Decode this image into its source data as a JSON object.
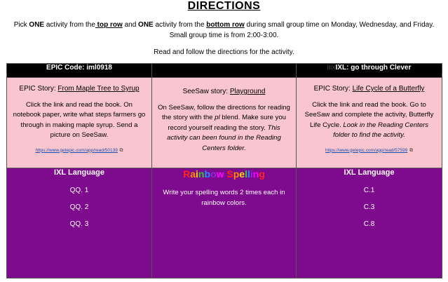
{
  "title": "DIRECTIONS",
  "intro": {
    "part1": "Pick ",
    "one_a": "ONE",
    "part2": " activity from the",
    "top_row": " top row",
    "part3": " and ",
    "one_b": "ONE",
    "part4": " activity from the ",
    "bottom_row": "bottom row",
    "part5": " during small group time on Monday, Wednesday, and Friday.  Small group time is from 2:00-3:00."
  },
  "read_follow": "Read and follow the directions for the activity.",
  "header": {
    "col1": "EPIC Code:  iml0918",
    "col2": "",
    "col3_ghost": "IIIX",
    "col3": "IXL:  go through Clever"
  },
  "top_row": {
    "epic": {
      "prefix": "EPIC Story:  ",
      "title": "From Maple Tree to Syrup",
      "body": "Click the link and read the book.  On notebook paper, write what steps farmers go through in making maple syrup. Send a picture on SeeSaw.",
      "link": "https://www.getepic.com/app/read/50139"
    },
    "seesaw": {
      "prefix": "SeeSaw story:  ",
      "title": "Playground",
      "body_plain": "On SeeSaw, follow the directions for reading the story with the ",
      "blend": "pl",
      "body_plain2": " blend.  Make sure you record yourself reading the story.  ",
      "body_italic": "This activity can been found in the Reading Centers folder."
    },
    "epic2": {
      "prefix": "EPIC Story:  ",
      "title": "Life Cycle of a Butterfly",
      "body_plain": "Click the link and read the book.  Go to SeeSaw and complete the activity, Butterfly Life Cycle.  ",
      "body_italic": "Look in the Reading Centers folder to find the activity.",
      "link": "https://www.getepic.com/app/read/57599"
    }
  },
  "bottom_row": {
    "ixl1": {
      "title": "IXL Language",
      "items": [
        "QQ. 1",
        "QQ. 2",
        "QQ. 3"
      ]
    },
    "spelling": {
      "rainbow_letters": [
        "R",
        "a",
        "i",
        "n",
        "b",
        "o",
        "w",
        " ",
        "S",
        "p",
        "e",
        "l",
        "l",
        "i",
        "n",
        "g"
      ],
      "rainbow_colors": [
        "#ff2020",
        "#ff8c00",
        "#ffd700",
        "#33cc33",
        "#1e90ff",
        "#8a2be2",
        "#ff00ff",
        "#ffffff",
        "#ff2020",
        "#ff8c00",
        "#ffd700",
        "#33cc33",
        "#1e90ff",
        "#8a2be2",
        "#ff00ff",
        "#ff2020"
      ],
      "body": "Write your spelling words 2 times each in rainbow colors."
    },
    "ixl2": {
      "title": "IXL Language",
      "items": [
        "C.1",
        "C.3",
        "C.8"
      ]
    }
  },
  "icons": {
    "external_link": "external-link-icon"
  }
}
